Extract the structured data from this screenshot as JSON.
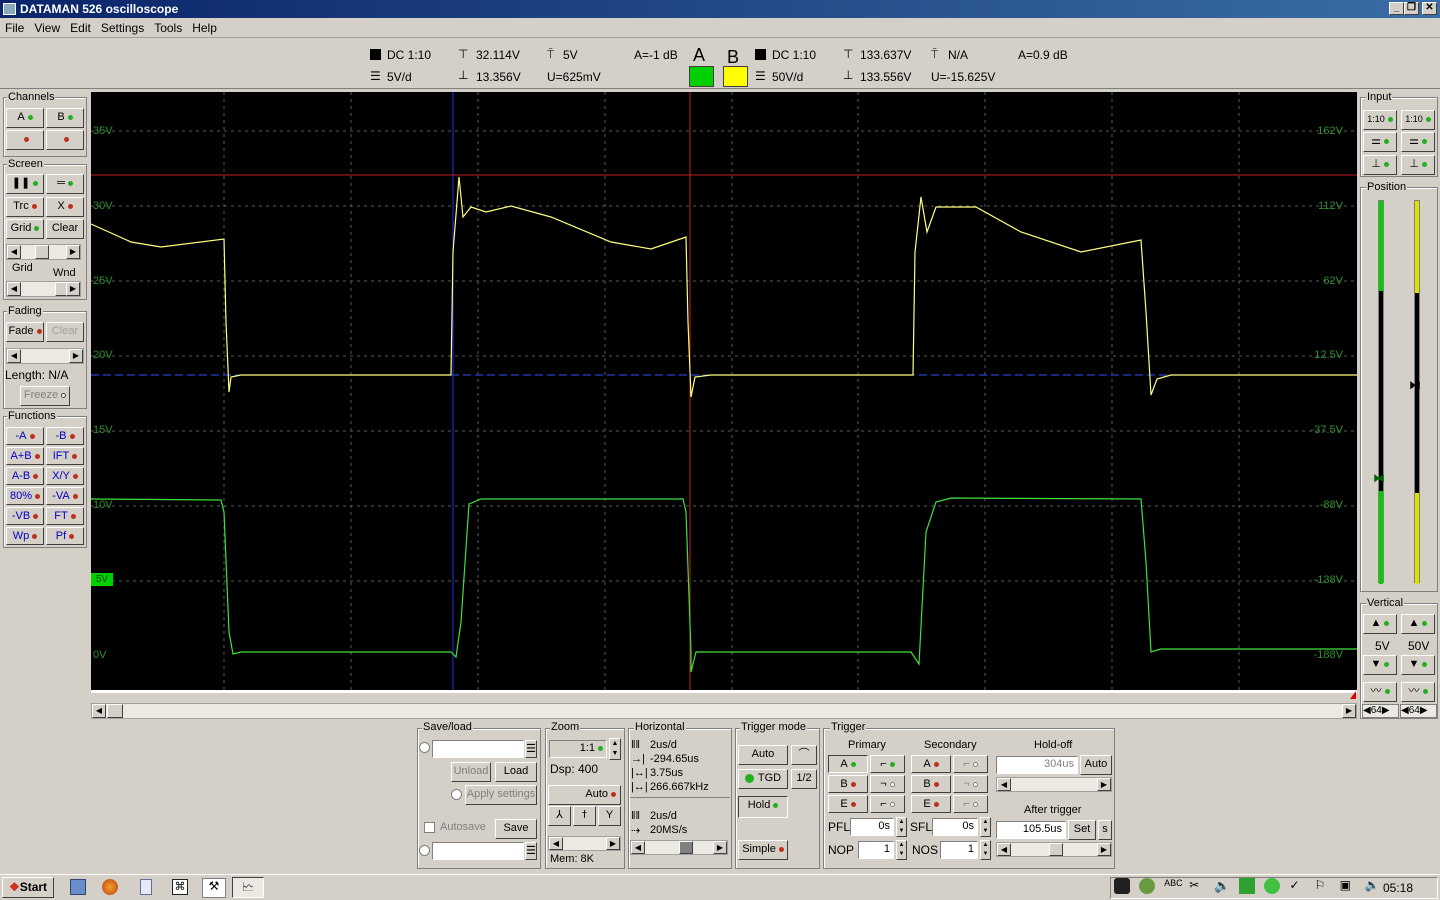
{
  "window": {
    "title": "DATAMAN 526 oscilloscope"
  },
  "menu": [
    "File",
    "View",
    "Edit",
    "Settings",
    "Tools",
    "Help"
  ],
  "channel_a": {
    "coupling": "DC 1:10",
    "volts_div": "5V/d",
    "vmax": "32.114V",
    "vmin": "13.356V",
    "trig_level": "5V",
    "u": "U=625mV",
    "gain": "A=-1 dB",
    "letter": "A",
    "color": "#00d000"
  },
  "channel_b": {
    "coupling": "DC 1:10",
    "volts_div": "50V/d",
    "vmax": "133.637V",
    "vmin": "133.556V",
    "trig_level": "N/A",
    "u": "U=-15.625V",
    "gain": "A=0.9 dB",
    "letter": "B",
    "color": "#ffff00"
  },
  "left": {
    "channels_title": "Channels",
    "ch_a": "A",
    "ch_b": "B",
    "screen_title": "Screen",
    "trc": "Trc",
    "x": "X",
    "grid": "Grid",
    "clear": "Clear",
    "grid_label": "Grid",
    "wnd_label": "Wnd",
    "fading_title": "Fading",
    "fade": "Fade",
    "fade_clear": "Clear",
    "length": "Length: N/A",
    "freeze": "Freeze",
    "functions_title": "Functions",
    "functions": [
      [
        "-A",
        "-B"
      ],
      [
        "A+B",
        "IFT"
      ],
      [
        "A-B",
        "X/Y"
      ],
      [
        "80%",
        "-VA"
      ],
      [
        "-VB",
        "FT"
      ],
      [
        "Wp",
        "Pf"
      ]
    ]
  },
  "right": {
    "input_title": "Input",
    "in_a": "1:10",
    "in_b": "1:10",
    "position_title": "Position",
    "vertical_title": "Vertical",
    "vert_a": "5V",
    "vert_b": "50V",
    "avg_a": "64",
    "avg_b": "64"
  },
  "scope": {
    "left_axis": [
      "35V",
      "30V",
      "25V",
      "20V",
      "15V",
      "10V",
      "5V",
      "0V"
    ],
    "right_axis": [
      "162V",
      "112V",
      "62V",
      "12.5V",
      "-37.5V",
      "-88V",
      "-138V",
      "-188V"
    ],
    "marker_label": "5V"
  },
  "saveload": {
    "title": "Save/load",
    "unload": "Unload",
    "load": "Load",
    "apply": "Apply settings",
    "autosave": "Autosave",
    "save": "Save"
  },
  "zoom": {
    "title": "Zoom",
    "value": "1:1",
    "dsp": "Dsp:  400",
    "auto": "Auto",
    "mem": "Mem: 8K"
  },
  "horizontal": {
    "title": "Horizontal",
    "tdiv": "2us/d",
    "offset": "-294.65us",
    "dt": "3.75us",
    "freq": "266.667kHz",
    "tdiv2": "2us/d",
    "rate": "20MS/s"
  },
  "trigger_mode": {
    "title": "Trigger mode",
    "auto": "Auto",
    "tgd": "TGD",
    "half": "1/2",
    "hold": "Hold",
    "simple": "Simple"
  },
  "trigger": {
    "title": "Trigger",
    "primary": "Primary",
    "secondary": "Secondary",
    "holdoff": "Hold-off",
    "holdoff_val": "304us",
    "holdoff_auto": "Auto",
    "after": "After trigger",
    "after_val": "105.5us",
    "set": "Set",
    "s": "s",
    "pfl": "PFL",
    "pfl_val": "0s",
    "sfl": "SFL",
    "sfl_val": "0s",
    "nop": "NOP",
    "nop_val": "1",
    "nos": "NOS",
    "nos_val": "1",
    "a": "A",
    "b": "B",
    "e": "E"
  },
  "taskbar": {
    "start": "Start",
    "time": "05:18"
  }
}
